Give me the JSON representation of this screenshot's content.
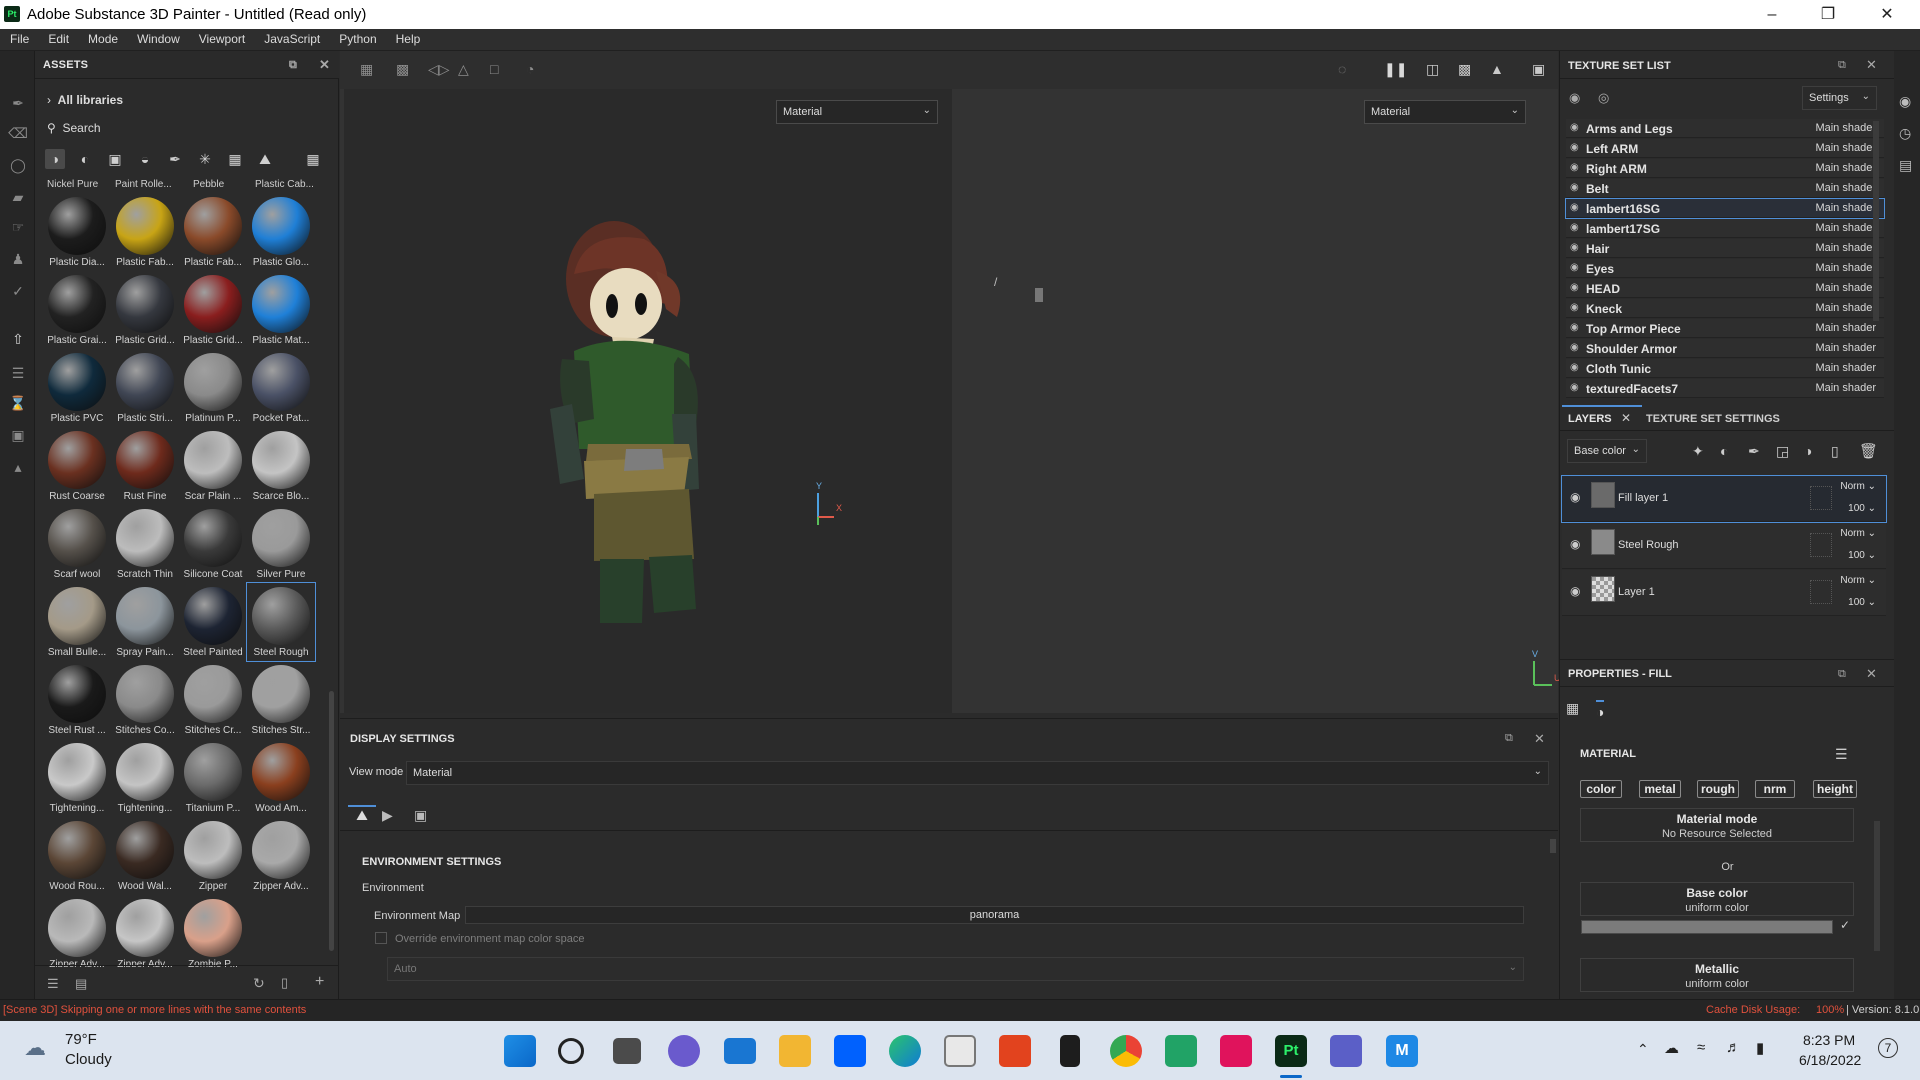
{
  "window": {
    "title": "Adobe Substance 3D Painter - Untitled (Read only)",
    "logo": "Pt"
  },
  "menu": [
    "File",
    "Edit",
    "Mode",
    "Window",
    "Viewport",
    "JavaScript",
    "Python",
    "Help"
  ],
  "assets": {
    "title": "ASSETS",
    "all_libraries": "All libraries",
    "search_placeholder": "Search",
    "top_row": [
      "Nickel Pure",
      "Paint Rolle...",
      "Pebble",
      "Plastic Cab..."
    ],
    "tiles": [
      {
        "name": "Plastic Dia...",
        "color": "#1c1c1c"
      },
      {
        "name": "Plastic Fab...",
        "color": "#c8a415"
      },
      {
        "name": "Plastic Fab...",
        "color": "#8a4a2a"
      },
      {
        "name": "Plastic Glo...",
        "color": "#1f7fd6"
      },
      {
        "name": "Plastic Grai...",
        "color": "#222"
      },
      {
        "name": "Plastic Grid...",
        "color": "#35383f"
      },
      {
        "name": "Plastic Grid...",
        "color": "#8a1e1e"
      },
      {
        "name": "Plastic Mat...",
        "color": "#1f80d8"
      },
      {
        "name": "Plastic PVC",
        "color": "#0f2a3c"
      },
      {
        "name": "Plastic Stri...",
        "color": "#404654"
      },
      {
        "name": "Platinum P...",
        "color": "#8a8a8a"
      },
      {
        "name": "Pocket Pat...",
        "color": "#4a5166"
      },
      {
        "name": "Rust Coarse",
        "color": "#6a3020"
      },
      {
        "name": "Rust Fine",
        "color": "#6e2a1c"
      },
      {
        "name": "Scar Plain ...",
        "color": "#bdbdbd"
      },
      {
        "name": "Scarce Blo...",
        "color": "#c4c4c4"
      },
      {
        "name": "Scarf wool",
        "color": "#55504a"
      },
      {
        "name": "Scratch Thin",
        "color": "#bcbcbc"
      },
      {
        "name": "Silicone Coat",
        "color": "#3a3a3a"
      },
      {
        "name": "Silver Pure",
        "color": "#9a9a9a"
      },
      {
        "name": "Small Bulle...",
        "color": "#a49a88"
      },
      {
        "name": "Spray Pain...",
        "color": "#8c959c"
      },
      {
        "name": "Steel Painted",
        "color": "#1d2433"
      },
      {
        "name": "Steel Rough",
        "color": "#5a5a5a"
      },
      {
        "name": "Steel Rust ...",
        "color": "#1a1a1a"
      },
      {
        "name": "Stitches Co...",
        "color": "#8a8a8a"
      },
      {
        "name": "Stitches Cr...",
        "color": "#9a9a9a"
      },
      {
        "name": "Stitches Str...",
        "color": "#a0a0a0"
      },
      {
        "name": "Tightening...",
        "color": "#c9c9c9"
      },
      {
        "name": "Tightening...",
        "color": "#c4c4c4"
      },
      {
        "name": "Titanium P...",
        "color": "#6a6a6a"
      },
      {
        "name": "Wood Am...",
        "color": "#8a3f1e"
      },
      {
        "name": "Wood Rou...",
        "color": "#5b4636"
      },
      {
        "name": "Wood Wal...",
        "color": "#3a2a22"
      },
      {
        "name": "Zipper",
        "color": "#bdbdbd"
      },
      {
        "name": "Zipper Adv...",
        "color": "#a9a9a9"
      },
      {
        "name": "Zipper Adv...",
        "color": "#b9b9b9"
      },
      {
        "name": "Zipper Adv...",
        "color": "#c6c6c6"
      },
      {
        "name": "Zombie P...",
        "color": "#d9a08a"
      }
    ],
    "selected_tile": "Steel Rough"
  },
  "viewport": {
    "left_mode": "Material",
    "right_mode": "Material",
    "axis_left": {
      "y": "Y",
      "x": "X"
    },
    "axis_right": {
      "y": "V",
      "x": "U"
    },
    "slash": "/"
  },
  "display_settings": {
    "title": "DISPLAY SETTINGS",
    "view_mode_label": "View mode",
    "view_mode_value": "Material",
    "env_header": "ENVIRONMENT SETTINGS",
    "environment_label": "Environment",
    "env_map_label": "Environment Map",
    "env_map_value": "panorama",
    "override_label": "Override environment map color space",
    "auto_value": "Auto"
  },
  "texture_set_list": {
    "title": "TEXTURE SET LIST",
    "settings_label": "Settings",
    "rows": [
      {
        "name": "Arms and Legs",
        "shader": "Main shader"
      },
      {
        "name": "Left ARM",
        "shader": "Main shader"
      },
      {
        "name": "Right ARM",
        "shader": "Main shader"
      },
      {
        "name": "Belt",
        "shader": "Main shader"
      },
      {
        "name": "lambert16SG",
        "shader": "Main shader"
      },
      {
        "name": "lambert17SG",
        "shader": "Main shader"
      },
      {
        "name": "Hair",
        "shader": "Main shader"
      },
      {
        "name": "Eyes",
        "shader": "Main shader"
      },
      {
        "name": "HEAD",
        "shader": "Main shader"
      },
      {
        "name": "Kneck",
        "shader": "Main shader"
      },
      {
        "name": "Top Armor Piece",
        "shader": "Main shader"
      },
      {
        "name": "Shoulder Armor",
        "shader": "Main shader"
      },
      {
        "name": "Cloth Tunic",
        "shader": "Main shader"
      },
      {
        "name": "texturedFacets7",
        "shader": "Main shader"
      }
    ],
    "selected": "lambert16SG"
  },
  "layers": {
    "tab_layers": "LAYERS",
    "tab_tss": "TEXTURE SET SETTINGS",
    "channel": "Base color",
    "items": [
      {
        "name": "Fill layer 1",
        "blend": "Norm",
        "opacity": "100"
      },
      {
        "name": "Steel Rough",
        "blend": "Norm",
        "opacity": "100"
      },
      {
        "name": "Layer 1",
        "blend": "Norm",
        "opacity": "100"
      }
    ]
  },
  "properties": {
    "title": "PROPERTIES - FILL",
    "material_header": "MATERIAL",
    "channels": [
      "color",
      "metal",
      "rough",
      "nrm",
      "height"
    ],
    "material_mode": "Material mode",
    "no_resource": "No Resource Selected",
    "or": "Or",
    "base_color": "Base color",
    "uniform1": "uniform color",
    "metallic": "Metallic",
    "uniform2": "uniform color"
  },
  "status": {
    "message": "[Scene 3D] Skipping one or more lines with the same contents",
    "cache_label": "Cache Disk Usage:",
    "cache_value": "100%",
    "version": "| Version: 8.1.0"
  },
  "taskbar": {
    "temp": "79°F",
    "weather": "Cloudy",
    "time": "8:23 PM",
    "date": "6/18/2022",
    "notif": "7"
  },
  "colors": {
    "accent": "#4f8fd8",
    "status_red": "#e0513d",
    "selection": "#4f8fd8"
  }
}
